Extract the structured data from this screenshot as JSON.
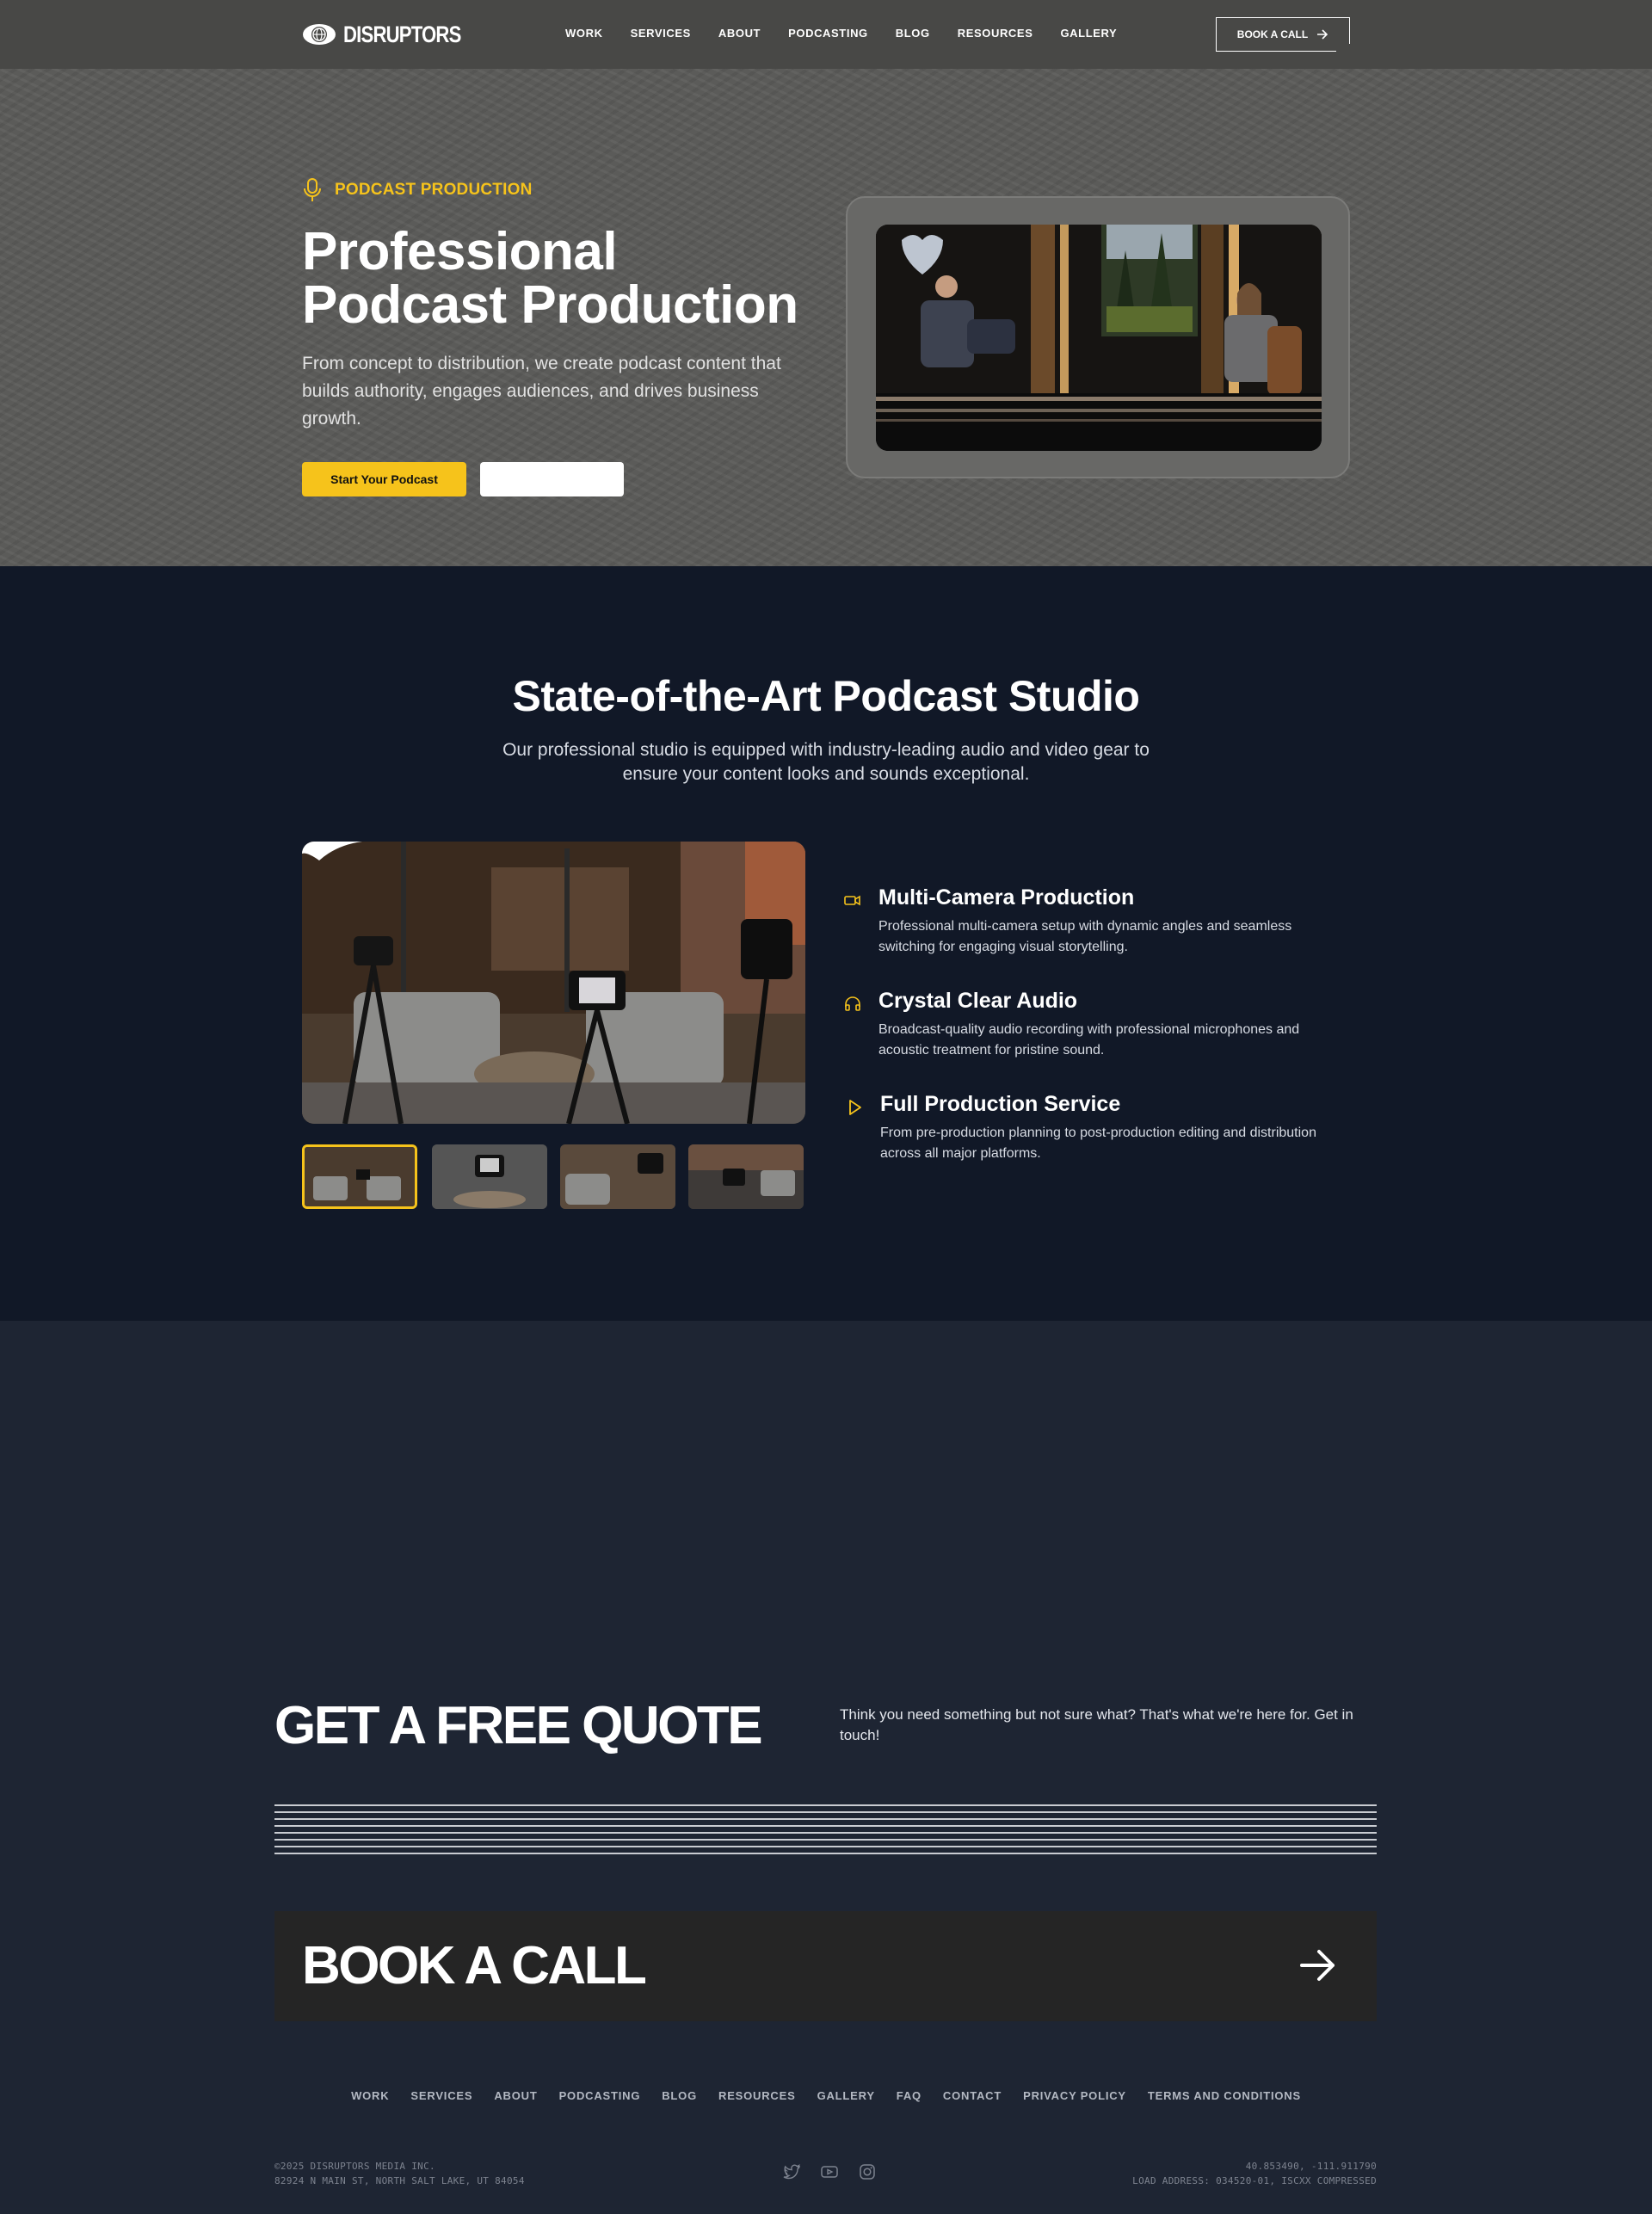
{
  "brand": {
    "name": "DISRUPTORS",
    "accent": "#f6c31b"
  },
  "nav": {
    "links": [
      "WORK",
      "SERVICES",
      "ABOUT",
      "PODCASTING",
      "BLOG",
      "RESOURCES",
      "GALLERY"
    ],
    "cta_label": "BOOK A CALL"
  },
  "hero": {
    "eyebrow": "PODCAST PRODUCTION",
    "title_line1": "Professional",
    "title_line2": "Podcast Production",
    "description": "From concept to distribution, we create podcast content that builds authority, engages audiences, and drives business growth.",
    "primary_button": "Start Your Podcast",
    "secondary_button": ""
  },
  "studio": {
    "title": "State-of-the-Art Podcast Studio",
    "subtitle": "Our professional studio is equipped with industry-leading audio and video gear to ensure your content looks and sounds exceptional.",
    "features": [
      {
        "icon": "video-camera-icon",
        "title": "Multi-Camera Production",
        "description": "Professional multi-camera setup with dynamic angles and seamless switching for engaging visual storytelling."
      },
      {
        "icon": "headphones-icon",
        "title": "Crystal Clear Audio",
        "description": "Broadcast-quality audio recording with professional microphones and acoustic treatment for pristine sound."
      },
      {
        "icon": "play-icon",
        "title": "Full Production Service",
        "description": "From pre-production planning to post-production editing and distribution across all major platforms."
      }
    ],
    "thumbnail_count": 4,
    "active_thumbnail": 1
  },
  "cta": {
    "quote_title": "GET A FREE QUOTE",
    "quote_text": "Think you need something but not sure what? That's what we're here for. Get in touch!",
    "book_label": "BOOK A CALL"
  },
  "footer": {
    "links": [
      "WORK",
      "SERVICES",
      "ABOUT",
      "PODCASTING",
      "BLOG",
      "RESOURCES",
      "GALLERY",
      "FAQ",
      "CONTACT",
      "PRIVACY POLICY",
      "TERMS AND CONDITIONS"
    ],
    "copyright": "©2025 DISRUPTORS MEDIA INC.",
    "address": "82924 N MAIN ST, NORTH SALT LAKE, UT 84054",
    "coordinates": "40.853490, -111.911790",
    "load_address": "LOAD ADDRESS: 034520-01, ISCXX COMPRESSED",
    "socials": [
      "twitter-icon",
      "youtube-icon",
      "instagram-icon"
    ]
  }
}
